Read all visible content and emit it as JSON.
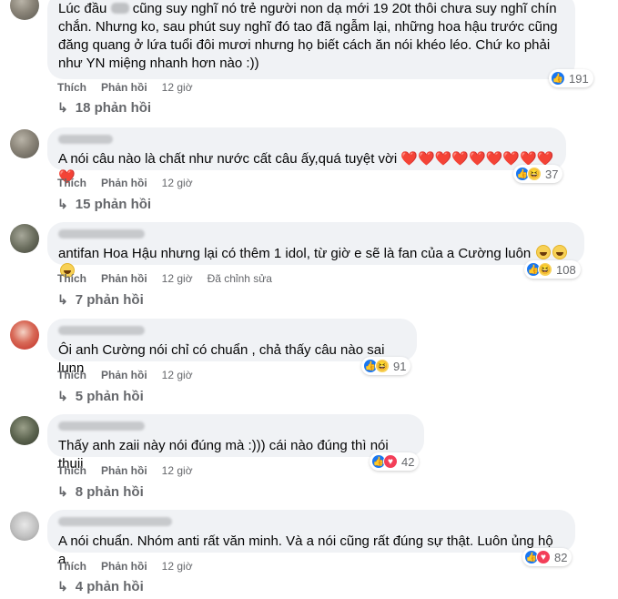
{
  "comments": [
    {
      "text_part1": "Lúc đầu ",
      "text_part2": " cũng suy nghĩ nó trẻ người non dạ mới 19 20t thôi chưa suy nghĩ chín chắn. Nhưng ko, sau phút suy nghĩ đó tao đã ngẫm lại, những hoa hậu trước cũng đăng quang ở lứa tuổi đôi mươi nhưng họ biết cách ăn nói khéo léo. Chứ ko phải như YN miệng nhanh hơn nào :))",
      "reaction_count": "191",
      "like_label": "Thích",
      "reply_label": "Phản hồi",
      "time": "12 giờ",
      "replies": "18 phản hồi",
      "reaction_icons": [
        "like-icon"
      ]
    },
    {
      "text": "A nói câu nào là chất như nước cất câu ấy,quá tuyệt vời",
      "hearts": "❤️❤️❤️❤️❤️❤️❤️❤️❤️❤️",
      "reaction_count": "37",
      "like_label": "Thích",
      "reply_label": "Phản hồi",
      "time": "12 giờ",
      "replies": "15 phản hồi",
      "reaction_icons": [
        "like-icon",
        "haha-icon"
      ]
    },
    {
      "text": "antifan Hoa Hậu nhưng lại có thêm 1 idol, từ giờ e sẽ là fan của a Cường luôn",
      "reaction_count": "108",
      "like_label": "Thích",
      "reply_label": "Phản hồi",
      "time": "12 giờ",
      "edited": "Đã chỉnh sửa",
      "replies": "7 phản hồi",
      "reaction_icons": [
        "like-icon",
        "haha-icon"
      ]
    },
    {
      "text": "Ôi anh Cường nói chỉ có chuẩn , chả thấy câu nào sai lunn",
      "reaction_count": "91",
      "like_label": "Thích",
      "reply_label": "Phản hồi",
      "time": "12 giờ",
      "replies": "5 phản hồi",
      "reaction_icons": [
        "like-icon",
        "haha-icon"
      ]
    },
    {
      "text": "Thấy anh zaii này nói đúng mà :))) cái nào đúng thì nói thuii",
      "reaction_count": "42",
      "like_label": "Thích",
      "reply_label": "Phản hồi",
      "time": "12 giờ",
      "replies": "8 phản hồi",
      "reaction_icons": [
        "like-icon",
        "love-icon"
      ]
    },
    {
      "text": "A nói chuẩn. Nhóm anti rất văn minh. Và a nói cũng rất đúng sự thật. Luôn ủng hộ a.",
      "reaction_count": "82",
      "like_label": "Thích",
      "reply_label": "Phản hồi",
      "time": "12 giờ",
      "replies": "4 phản hồi",
      "reaction_icons": [
        "like-icon",
        "love-icon"
      ]
    }
  ],
  "colors": {
    "bubble": "#f0f2f5",
    "secondary_text": "#65676b",
    "like_blue": "#1877f2",
    "heart_red": "#e41e3f"
  }
}
